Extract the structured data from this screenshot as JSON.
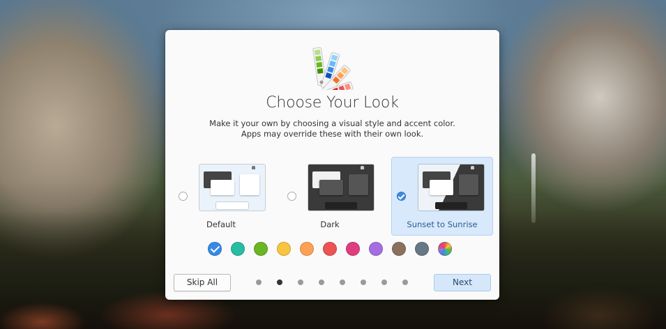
{
  "dialog": {
    "title": "Choose Your Look",
    "subtitle": "Make it your own by choosing a visual style and accent color. Apps may override these with their own look.",
    "icon": "color-palette-icon"
  },
  "styles": [
    {
      "label": "Default",
      "selected": false
    },
    {
      "label": "Dark",
      "selected": false
    },
    {
      "label": "Sunset to Sunrise",
      "selected": true
    }
  ],
  "accent_colors": [
    {
      "name": "blue",
      "color": "#3689e6",
      "selected": true
    },
    {
      "name": "mint",
      "color": "#28bca3",
      "selected": false
    },
    {
      "name": "green",
      "color": "#68b723",
      "selected": false
    },
    {
      "name": "yellow",
      "color": "#f9c440",
      "selected": false
    },
    {
      "name": "orange",
      "color": "#ffa154",
      "selected": false
    },
    {
      "name": "red",
      "color": "#ed5353",
      "selected": false
    },
    {
      "name": "pink",
      "color": "#de3e80",
      "selected": false
    },
    {
      "name": "purple",
      "color": "#a56de2",
      "selected": false
    },
    {
      "name": "brown",
      "color": "#8a715e",
      "selected": false
    },
    {
      "name": "gray",
      "color": "#667885",
      "selected": false
    },
    {
      "name": "multicolor",
      "color": "conic",
      "selected": false
    }
  ],
  "pagination": {
    "total": 8,
    "current": 2
  },
  "buttons": {
    "skip_label": "Skip All",
    "next_label": "Next"
  }
}
